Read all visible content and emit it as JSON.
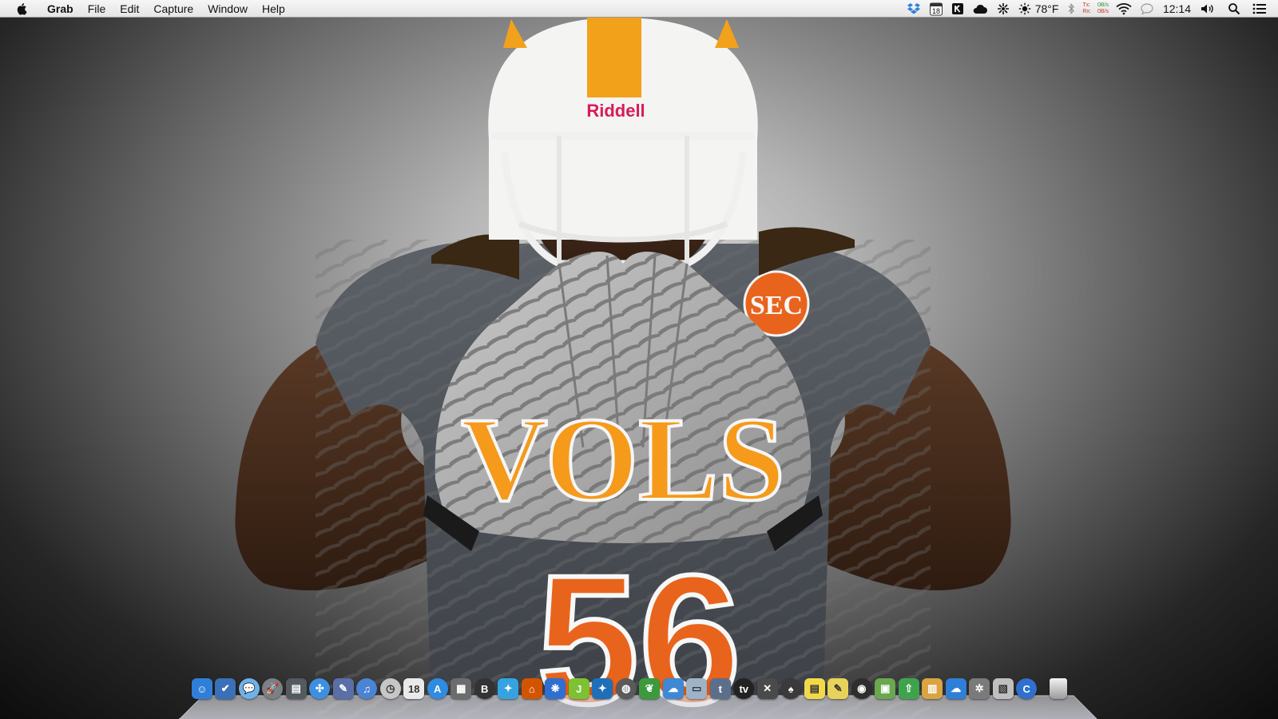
{
  "menubar": {
    "app_name": "Grab",
    "items": [
      "File",
      "Edit",
      "Capture",
      "Window",
      "Help"
    ],
    "calendar_day": "18",
    "temperature": "78°F",
    "net_tx_label": "Tx:",
    "net_rx_label": "Rx:",
    "net_tx_value": "0B/s",
    "net_rx_value": "0B/s",
    "clock": "12:14"
  },
  "wallpaper": {
    "helmet_brand": "Riddell",
    "glove_text": "VOLS",
    "jersey_number": "56",
    "patch_text": "SEC"
  },
  "dock": {
    "items": [
      {
        "name": "finder-icon",
        "glyph": "☺",
        "color": "#2f7fd8",
        "round": false
      },
      {
        "name": "reminders-icon",
        "glyph": "✔",
        "color": "#3b6fb8",
        "round": false
      },
      {
        "name": "messages-icon",
        "glyph": "💬",
        "color": "#6fb2ea",
        "round": true
      },
      {
        "name": "launchpad-icon",
        "glyph": "🚀",
        "color": "#7b7f86",
        "round": true
      },
      {
        "name": "dashboard-icon",
        "glyph": "▤",
        "color": "#555a60",
        "round": false
      },
      {
        "name": "safari-icon",
        "glyph": "✣",
        "color": "#3d8fe0",
        "round": true
      },
      {
        "name": "preview-icon",
        "glyph": "✎",
        "color": "#5a6fa8",
        "round": false
      },
      {
        "name": "itunes-icon",
        "glyph": "♫",
        "color": "#4a84d4",
        "round": true
      },
      {
        "name": "clock-icon",
        "glyph": "◷",
        "color": "#c6c6c6",
        "round": true
      },
      {
        "name": "calendar-icon",
        "glyph": "18",
        "color": "#e9e9e9",
        "round": false
      },
      {
        "name": "app-store-icon",
        "glyph": "A",
        "color": "#2f8ce0",
        "round": true
      },
      {
        "name": "photo-booth-icon",
        "glyph": "▦",
        "color": "#6c6c6c",
        "round": false
      },
      {
        "name": "bbedit-icon",
        "glyph": "B",
        "color": "#333333",
        "round": true
      },
      {
        "name": "twitter-icon",
        "glyph": "✦",
        "color": "#35a3e0",
        "round": false
      },
      {
        "name": "home-icon",
        "glyph": "⌂",
        "color": "#d35400",
        "round": false
      },
      {
        "name": "fish-icon",
        "glyph": "❋",
        "color": "#2f6fd0",
        "round": false
      },
      {
        "name": "jaksta-icon",
        "glyph": "J",
        "color": "#7cc232",
        "round": false
      },
      {
        "name": "tweetbot-icon",
        "glyph": "✦",
        "color": "#1f6fb8",
        "round": false
      },
      {
        "name": "globe-icon",
        "glyph": "◍",
        "color": "#5a5a5a",
        "round": true
      },
      {
        "name": "evernote-icon",
        "glyph": "❦",
        "color": "#3c9a3c",
        "round": false
      },
      {
        "name": "cloud-icon",
        "glyph": "☁",
        "color": "#3f88d6",
        "round": false
      },
      {
        "name": "disk-icon",
        "glyph": "▭",
        "color": "#9fb3c8",
        "round": false
      },
      {
        "name": "textedit-icon",
        "glyph": "t",
        "color": "#5c6f8a",
        "round": false
      },
      {
        "name": "tv-icon",
        "glyph": "tv",
        "color": "#222222",
        "round": true
      },
      {
        "name": "tools-icon",
        "glyph": "✕",
        "color": "#4a4a4a",
        "round": false
      },
      {
        "name": "spade-icon",
        "glyph": "♠",
        "color": "#3a3a3a",
        "round": true
      },
      {
        "name": "stickies-icon",
        "glyph": "▤",
        "color": "#f2d94a",
        "round": false
      },
      {
        "name": "notes-icon",
        "glyph": "✎",
        "color": "#e8d35a",
        "round": false
      },
      {
        "name": "color-picker-icon",
        "glyph": "◉",
        "color": "#2e2e2e",
        "round": true
      },
      {
        "name": "monitor-icon",
        "glyph": "▣",
        "color": "#6aa84f",
        "round": false
      },
      {
        "name": "upload-icon",
        "glyph": "⇧",
        "color": "#3fa34d",
        "round": false
      },
      {
        "name": "calculator-icon",
        "glyph": "▥",
        "color": "#d9a441",
        "round": false
      },
      {
        "name": "cloud-download-icon",
        "glyph": "☁",
        "color": "#2f7fd8",
        "round": false
      },
      {
        "name": "system-preferences-icon",
        "glyph": "✲",
        "color": "#7a7a7a",
        "round": false
      },
      {
        "name": "image-capture-icon",
        "glyph": "▧",
        "color": "#bfbfbf",
        "round": false
      },
      {
        "name": "c-app-icon",
        "glyph": "C",
        "color": "#2f6fd0",
        "round": true
      }
    ]
  }
}
